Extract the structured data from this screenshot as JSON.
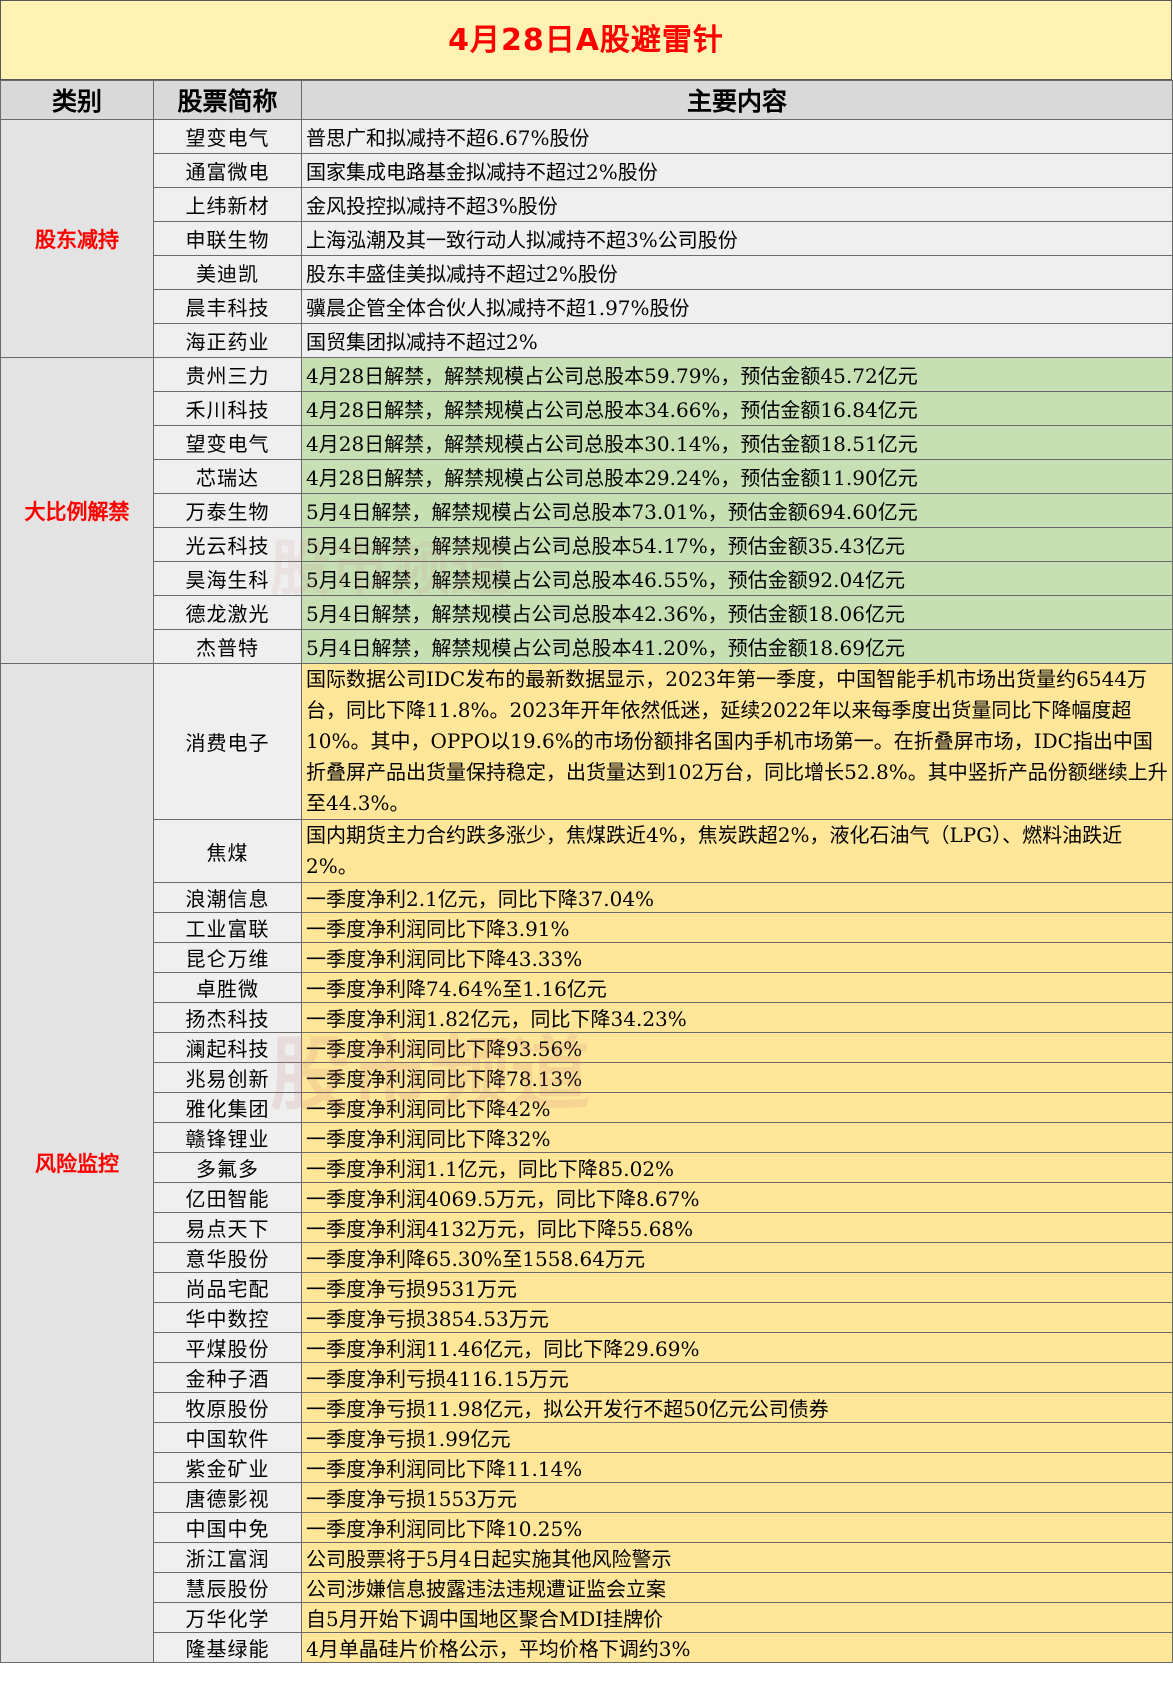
{
  "title": "4月28日A股避雷针",
  "headers": {
    "category": "类别",
    "stock": "股票简称",
    "content": "主要内容"
  },
  "watermark": "股市频道",
  "groups": {
    "reduction": {
      "label": "股东减持",
      "rows": [
        {
          "name": "望变电气",
          "content": "普思广和拟减持不超6.67%股份"
        },
        {
          "name": "通富微电",
          "content": "国家集成电路基金拟减持不超过2%股份"
        },
        {
          "name": "上纬新材",
          "content": "金风投控拟减持不超3%股份"
        },
        {
          "name": "申联生物",
          "content": "上海泓潮及其一致行动人拟减持不超3%公司股份"
        },
        {
          "name": "美迪凯",
          "content": "股东丰盛佳美拟减持不超过2%股份"
        },
        {
          "name": "晨丰科技",
          "content": "骥晨企管全体合伙人拟减持不超1.97%股份"
        },
        {
          "name": "海正药业",
          "content": "国贸集团拟减持不超过2%"
        }
      ]
    },
    "unlock": {
      "label": "大比例解禁",
      "rows": [
        {
          "name": "贵州三力",
          "content": "4月28日解禁，解禁规模占公司总股本59.79%，预估金额45.72亿元"
        },
        {
          "name": "禾川科技",
          "content": "4月28日解禁，解禁规模占公司总股本34.66%，预估金额16.84亿元"
        },
        {
          "name": "望变电气",
          "content": "4月28日解禁，解禁规模占公司总股本30.14%，预估金额18.51亿元"
        },
        {
          "name": "芯瑞达",
          "content": "4月28日解禁，解禁规模占公司总股本29.24%，预估金额11.90亿元"
        },
        {
          "name": "万泰生物",
          "content": "5月4日解禁，解禁规模占公司总股本73.01%，预估金额694.60亿元"
        },
        {
          "name": "光云科技",
          "content": "5月4日解禁，解禁规模占公司总股本54.17%，预估金额35.43亿元"
        },
        {
          "name": "昊海生科",
          "content": "5月4日解禁，解禁规模占公司总股本46.55%，预估金额92.04亿元"
        },
        {
          "name": "德龙激光",
          "content": "5月4日解禁，解禁规模占公司总股本42.36%，预估金额18.06亿元"
        },
        {
          "name": "杰普特",
          "content": "5月4日解禁，解禁规模占公司总股本41.20%，预估金额18.69亿元"
        }
      ]
    },
    "risk": {
      "label": "风险监控",
      "rows": [
        {
          "name": "消费电子",
          "content": "国际数据公司IDC发布的最新数据显示，2023年第一季度，中国智能手机市场出货量约6544万台，同比下降11.8%。2023年开年依然低迷，延续2022年以来每季度出货量同比下降幅度超10%。其中，OPPO以19.6%的市场份额排名国内手机市场第一。在折叠屏市场，IDC指出中国折叠屏产品出货量保持稳定，出货量达到102万台，同比增长52.8%。其中竖折产品份额继续上升至44.3%。"
        },
        {
          "name": "焦煤",
          "content": "国内期货主力合约跌多涨少，焦煤跌近4%，焦炭跌超2%，液化石油气（LPG）、燃料油跌近2%。"
        },
        {
          "name": "浪潮信息",
          "content": "一季度净利2.1亿元，同比下降37.04%"
        },
        {
          "name": "工业富联",
          "content": "一季度净利润同比下降3.91%"
        },
        {
          "name": "昆仑万维",
          "content": "一季度净利润同比下降43.33%"
        },
        {
          "name": "卓胜微",
          "content": "一季度净利降74.64%至1.16亿元"
        },
        {
          "name": "扬杰科技",
          "content": "一季度净利润1.82亿元，同比下降34.23%"
        },
        {
          "name": "澜起科技",
          "content": "一季度净利润同比下降93.56%"
        },
        {
          "name": "兆易创新",
          "content": "一季度净利润同比下降78.13%"
        },
        {
          "name": "雅化集团",
          "content": "一季度净利润同比下降42%"
        },
        {
          "name": "赣锋锂业",
          "content": "一季度净利润同比下降32%"
        },
        {
          "name": "多氟多",
          "content": "一季度净利润1.1亿元，同比下降85.02%"
        },
        {
          "name": "亿田智能",
          "content": "一季度净利润4069.5万元，同比下降8.67%"
        },
        {
          "name": "易点天下",
          "content": "一季度净利润4132万元，同比下降55.68%"
        },
        {
          "name": "意华股份",
          "content": "一季度净利降65.30%至1558.64万元"
        },
        {
          "name": "尚品宅配",
          "content": "一季度净亏损9531万元"
        },
        {
          "name": "华中数控",
          "content": "一季度净亏损3854.53万元"
        },
        {
          "name": "平煤股份",
          "content": "一季度净利润11.46亿元，同比下降29.69%"
        },
        {
          "name": "金种子酒",
          "content": "一季度净利亏损4116.15万元"
        },
        {
          "name": "牧原股份",
          "content": "一季度净亏损11.98亿元，拟公开发行不超50亿元公司债券"
        },
        {
          "name": "中国软件",
          "content": "一季度净亏损1.99亿元"
        },
        {
          "name": "紫金矿业",
          "content": "一季度净利润同比下降11.14%"
        },
        {
          "name": "唐德影视",
          "content": "一季度净亏损1553万元"
        },
        {
          "name": "中国中免",
          "content": "一季度净利润同比下降10.25%"
        },
        {
          "name": "浙江富润",
          "content": "公司股票将于5月4日起实施其他风险警示"
        },
        {
          "name": "慧辰股份",
          "content": "公司涉嫌信息披露违法违规遭证监会立案"
        },
        {
          "name": "万华化学",
          "content": "自5月开始下调中国地区聚合MDI挂牌价"
        },
        {
          "name": "隆基绿能",
          "content": "4月单晶硅片价格公示，平均价格下调约3%"
        }
      ]
    }
  }
}
